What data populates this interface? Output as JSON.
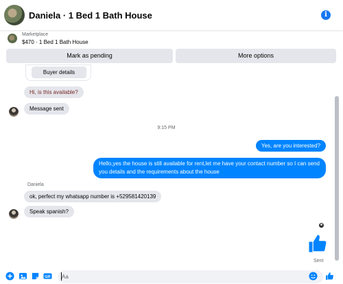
{
  "header": {
    "title": "Daniela · 1 Bed 1 Bath House"
  },
  "marketplace": {
    "label": "Marketplace",
    "listing": "$470 · 1 Bed 1 Bath House"
  },
  "actions": {
    "pending": "Mark as pending",
    "more": "More options"
  },
  "buyer_card": {
    "label": "Buyer details"
  },
  "messages": [
    {
      "dir": "in",
      "text": "Hi, is this available?"
    },
    {
      "dir": "in",
      "text": "Message sent"
    },
    {
      "dir": "time",
      "text": "9:15 PM"
    },
    {
      "dir": "out",
      "text": "Yes, are you interested?"
    },
    {
      "dir": "out",
      "text": "Hello,yes the house is still available for rent,let me have your contact number so I can send you details and the requirements about the house"
    },
    {
      "dir": "sender",
      "text": "Daniela"
    },
    {
      "dir": "in",
      "text": "ok, perfect my whatsapp number is +529581420139"
    },
    {
      "dir": "in",
      "text": "Speak spanish?"
    }
  ],
  "status": {
    "sent_label": "Sent"
  },
  "composer": {
    "placeholder": "Aa"
  },
  "colors": {
    "accent": "#0084ff",
    "incoming": "#e4e6eb"
  }
}
